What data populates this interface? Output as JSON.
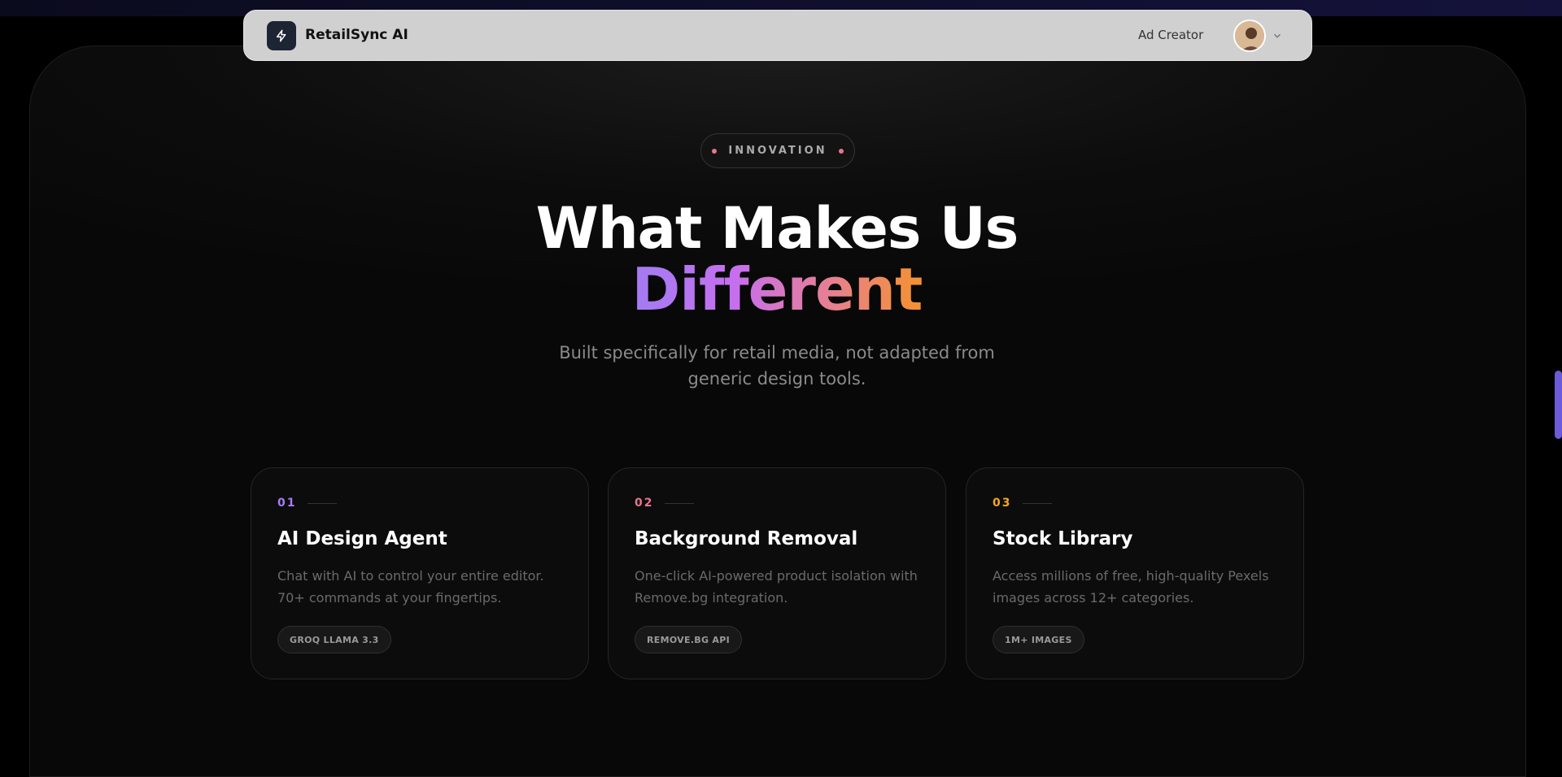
{
  "navbar": {
    "brand": "RetailSync AI",
    "nav_link": "Ad Creator"
  },
  "hero": {
    "badge": "INNOVATION",
    "title_line1": "What Makes Us",
    "title_line2": "Different",
    "subtitle": "Built specifically for retail media, not adapted from generic design tools."
  },
  "features": [
    {
      "number": "01",
      "title": "AI Design Agent",
      "description": "Chat with AI to control your entire editor. 70+ commands at your fingertips.",
      "tag": "GROQ LLAMA 3.3",
      "accent": "#a37cf2"
    },
    {
      "number": "02",
      "title": "Background Removal",
      "description": "One-click AI-powered product isolation with Remove.bg integration.",
      "tag": "REMOVE.BG API",
      "accent": "#e8748f"
    },
    {
      "number": "03",
      "title": "Stock Library",
      "description": "Access millions of free, high-quality Pexels images across 12+ categories.",
      "tag": "1M+ IMAGES",
      "accent": "#f5a623"
    }
  ],
  "icons": [
    "bolt-icon",
    "avatar",
    "chevron-down-icon"
  ]
}
